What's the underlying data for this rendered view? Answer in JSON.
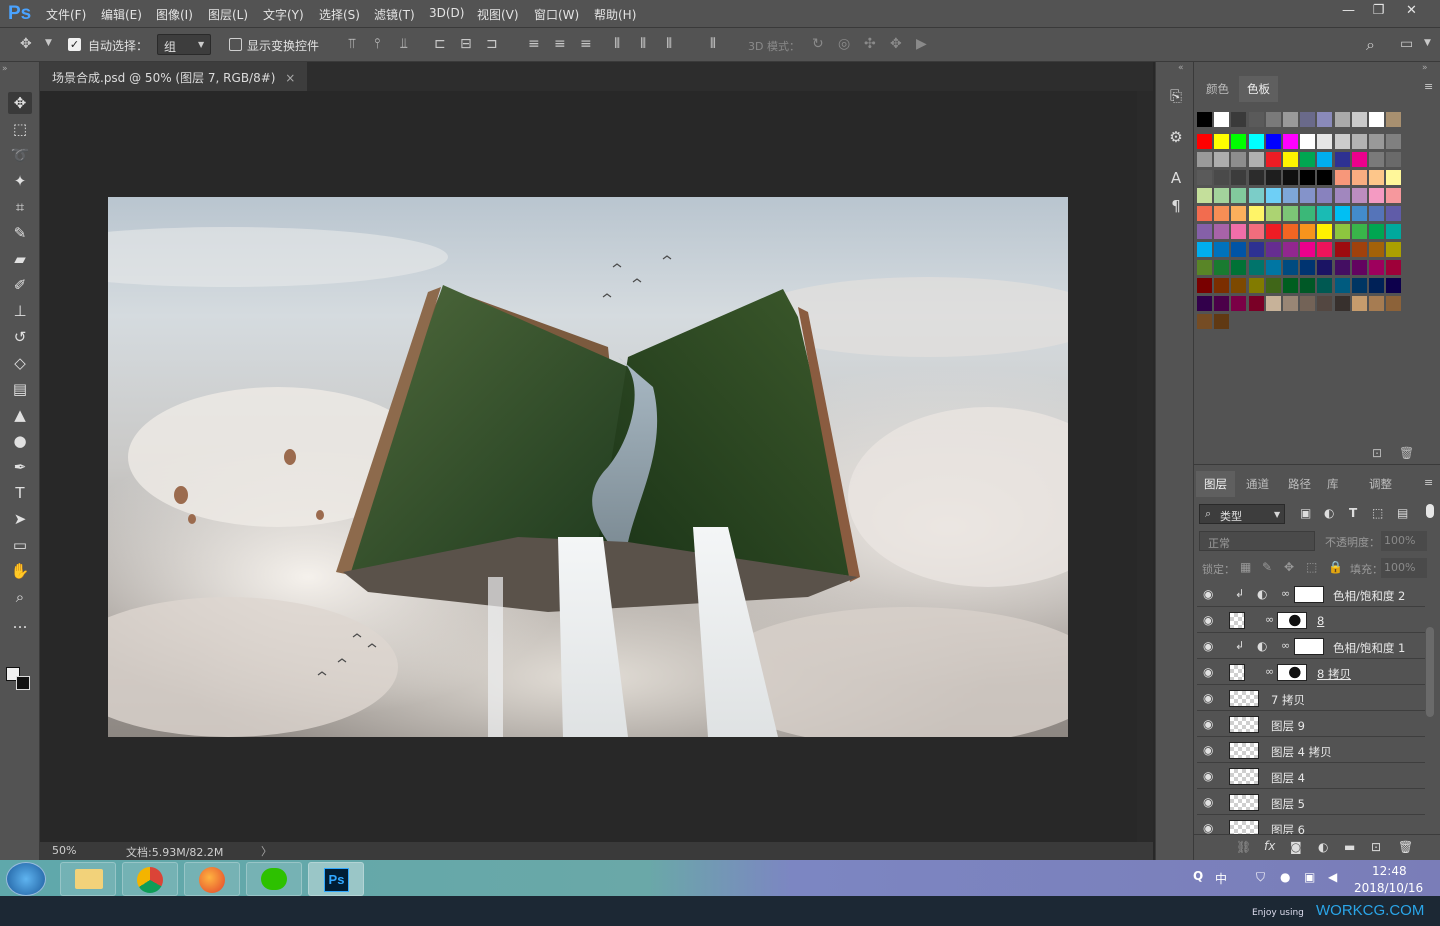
{
  "app": {
    "logo": "Ps"
  },
  "menubar": {
    "items": [
      "文件(F)",
      "编辑(E)",
      "图像(I)",
      "图层(L)",
      "文字(Y)",
      "选择(S)",
      "滤镜(T)",
      "3D(D)",
      "视图(V)",
      "窗口(W)",
      "帮助(H)"
    ],
    "window_controls": {
      "minimize": "—",
      "restore": "❐",
      "close": "✕"
    }
  },
  "options": {
    "auto_select_label": "自动选择：",
    "auto_select_checked": true,
    "auto_select_value": "组",
    "show_transform_label": "显示变换控件",
    "show_transform_checked": false,
    "mode_3d_label": "3D 模式："
  },
  "document": {
    "tab_title": "场景合成.psd @ 50% (图层 7, RGB/8#)",
    "tab_close": "×",
    "zoom": "50%",
    "doc_info": "文档:5.93M/82.2M"
  },
  "color_panel": {
    "tabs": [
      "颜色",
      "色板"
    ],
    "active_tab": "色板",
    "swatches_row0": [
      "#000000",
      "#ffffff",
      "#3a3a3a",
      "#5a5a5a",
      "#7a7a7a",
      "#9a9a9a",
      "#6a6a8a",
      "#8a8aba",
      "#aaaaaa",
      "#cacaca",
      "#ffffff",
      "#a89070"
    ],
    "swatches": [
      [
        "#ff0000",
        "#ffff00",
        "#00ff00",
        "#00ffff",
        "#0000ff",
        "#ff00ff",
        "#ffffff",
        "#e6e6e6",
        "#cccccc",
        "#b3b3b3",
        "#999999",
        "#808080"
      ],
      [
        "#9a9a9a",
        "#adadad",
        "#8d8d8d",
        "#b0b0b0",
        "#ee1c24",
        "#fff200",
        "#00a651",
        "#00aeef",
        "#2e3192",
        "#ec008c",
        "#7a7a7a",
        "#6a6a6a"
      ],
      [
        "#5a5a5a",
        "#4a4a4a",
        "#3c3c3c",
        "#2c2c2c",
        "#1e1e1e",
        "#101010",
        "#000000",
        "#000000",
        "#f7977a",
        "#f9ad81",
        "#fdc68a",
        "#fff79a"
      ],
      [
        "#c4df9b",
        "#a3d39c",
        "#82ca9d",
        "#7bcdc8",
        "#6ecff6",
        "#7ea7d8",
        "#8493ca",
        "#8882be",
        "#a187be",
        "#bc8dbf",
        "#f49ac2",
        "#f6989d"
      ],
      [
        "#f26c4f",
        "#f68e55",
        "#fbaf5c",
        "#fff467",
        "#acd372",
        "#7cc576",
        "#3bb878",
        "#1abbb4",
        "#00bff3",
        "#438ccb",
        "#5574b9",
        "#605ca8"
      ],
      [
        "#8560a8",
        "#a763a8",
        "#f06ea9",
        "#f26d7d",
        "#ed1c24",
        "#f26522",
        "#f7941d",
        "#fff200",
        "#8dc63f",
        "#39b54a",
        "#00a651",
        "#00a99d"
      ],
      [
        "#00aeef",
        "#0072bc",
        "#0054a6",
        "#2e3192",
        "#662d91",
        "#92278f",
        "#ec008c",
        "#ed145b",
        "#9e0b0f",
        "#a0410d",
        "#a36209",
        "#aba000"
      ],
      [
        "#598527",
        "#197b30",
        "#007236",
        "#00746b",
        "#0076a3",
        "#004b80",
        "#003471",
        "#1b1464",
        "#440e62",
        "#630460",
        "#9e005d",
        "#9e0039"
      ],
      [
        "#790000",
        "#7b2e00",
        "#7d4900",
        "#827b00",
        "#406618",
        "#005e20",
        "#005826",
        "#005952",
        "#005b7f",
        "#003663",
        "#002157",
        "#0d004c"
      ],
      [
        "#32004b",
        "#4b0049",
        "#7b0046",
        "#7a0026",
        "#c7b299",
        "#998675",
        "#736357",
        "#534741",
        "#37302d",
        "#c69c6d",
        "#a67c52",
        "#8c6239"
      ],
      [
        "#754c24",
        "#603913"
      ]
    ]
  },
  "layers_panel": {
    "tabs": [
      "图层",
      "通道",
      "路径",
      "库",
      "调整"
    ],
    "active_tab": "图层",
    "filter_kind": "类型",
    "blend_mode": "正常",
    "opacity_label": "不透明度：",
    "opacity_value": "100%",
    "lock_label": "锁定：",
    "fill_label": "填充：",
    "fill_value": "100%",
    "layers": [
      {
        "name": "色相/饱和度 2",
        "kind": "adjustment"
      },
      {
        "name": "8",
        "kind": "masked"
      },
      {
        "name": "色相/饱和度 1",
        "kind": "adjustment"
      },
      {
        "name": "8 拷贝",
        "kind": "masked"
      },
      {
        "name": "7 拷贝",
        "kind": "smart"
      },
      {
        "name": "图层 9",
        "kind": "pixel"
      },
      {
        "name": "图层 4 拷贝",
        "kind": "pixel"
      },
      {
        "name": "图层 4",
        "kind": "pixel"
      },
      {
        "name": "图层 5",
        "kind": "pixel"
      },
      {
        "name": "图层 6",
        "kind": "pixel"
      }
    ],
    "footer_fx": "fx"
  },
  "taskbar": {
    "ps_label": "Ps",
    "tray": {
      "ime": "中",
      "time": "12:48",
      "date": "2018/10/16"
    }
  },
  "watermark": {
    "enjoy": "Enjoy using",
    "site": "WORKCG.COM"
  },
  "tool_icons": [
    "move-icon",
    "marquee-icon",
    "lasso-icon",
    "magic-wand-icon",
    "crop-icon",
    "eyedropper-icon",
    "healing-brush-icon",
    "brush-icon",
    "clone-stamp-icon",
    "history-brush-icon",
    "eraser-icon",
    "gradient-icon",
    "blur-icon",
    "dodge-icon",
    "pen-icon",
    "type-icon",
    "path-select-icon",
    "rectangle-icon",
    "hand-icon",
    "zoom-icon",
    "more-tools-icon"
  ],
  "mid_panel_icons": [
    "history-icon",
    "properties-icon",
    "character-icon",
    "paragraph-icon"
  ]
}
